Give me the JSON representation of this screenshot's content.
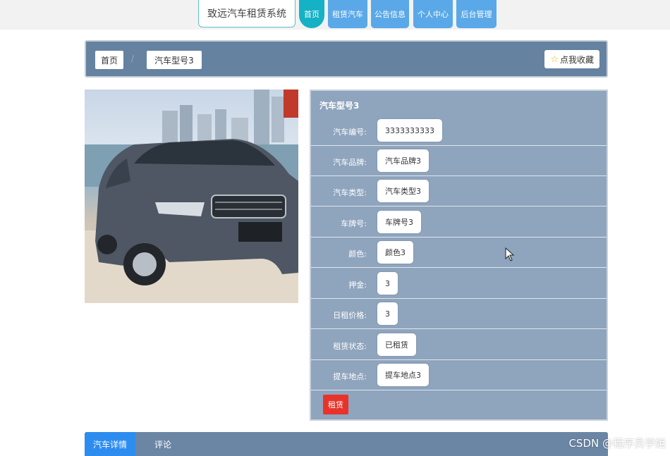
{
  "nav": {
    "site_title": "致远汽车租赁系统",
    "items": [
      {
        "label": "首页",
        "active": true
      },
      {
        "label": "租赁汽车",
        "active": false
      },
      {
        "label": "公告信息",
        "active": false
      },
      {
        "label": "个人中心",
        "active": false
      },
      {
        "label": "后台管理",
        "active": false
      }
    ]
  },
  "breadcrumb": {
    "home": "首页",
    "separator": "/",
    "current": "汽车型号3",
    "favorite_label": "点我收藏"
  },
  "detail": {
    "title": "汽车型号3",
    "fields": [
      {
        "label": "汽车编号:",
        "value": "3333333333"
      },
      {
        "label": "汽车品牌:",
        "value": "汽车品牌3"
      },
      {
        "label": "汽车类型:",
        "value": "汽车类型3"
      },
      {
        "label": "车牌号:",
        "value": "车牌号3"
      },
      {
        "label": "颜色:",
        "value": "颜色3"
      },
      {
        "label": "押金:",
        "value": "3"
      },
      {
        "label": "日租价格:",
        "value": "3"
      },
      {
        "label": "租赁状态:",
        "value": "已租赁"
      },
      {
        "label": "提车地点:",
        "value": "提车地点3"
      }
    ],
    "rent_label": "租赁"
  },
  "tabs": [
    {
      "label": "汽车详情",
      "active": true
    },
    {
      "label": "评论",
      "active": false
    }
  ],
  "watermark": "CSDN @程序员学姐",
  "colors": {
    "nav_blue": "#5aa8e8",
    "nav_active": "#15b1c5",
    "panel_bg": "#8fa4bd",
    "bar_bg": "#6582a0",
    "rent_red": "#e8332a",
    "tab_active": "#2d8cf0"
  }
}
